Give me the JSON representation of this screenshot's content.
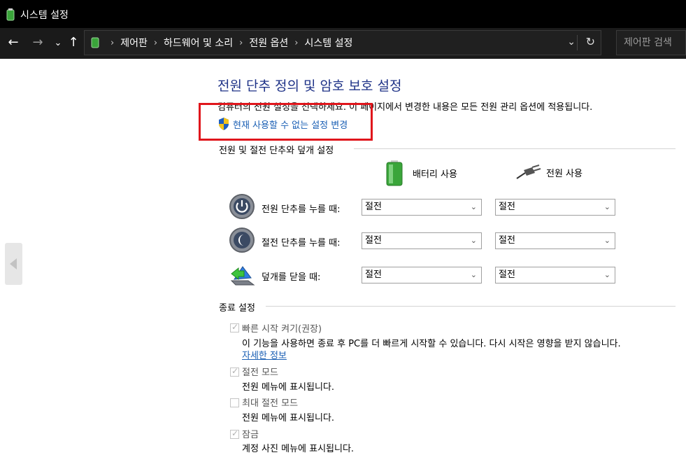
{
  "window": {
    "title": "시스템 설정"
  },
  "breadcrumbs": [
    "제어판",
    "하드웨어 및 소리",
    "전원 옵션",
    "시스템 설정"
  ],
  "search": {
    "placeholder": "제어판 검색"
  },
  "main": {
    "heading": "전원 단추 정의 및 암호 보호 설정",
    "description": "컴퓨터의 전원 설정을 선택하세요. 이 페이지에서 변경한 내용은 모든 전원 관리 옵션에 적용됩니다.",
    "change_link": "현재 사용할 수 없는 설정 변경",
    "power_section": {
      "title": "전원 및 절전 단추와 덮개 설정",
      "col_battery": "배터리 사용",
      "col_plugged": "전원 사용",
      "rows": [
        {
          "label": "전원 단추를 누를 때:",
          "battery": "절전",
          "plugged": "절전"
        },
        {
          "label": "절전 단추를 누를 때:",
          "battery": "절전",
          "plugged": "절전"
        },
        {
          "label": "덮개를 닫을 때:",
          "battery": "절전",
          "plugged": "절전"
        }
      ]
    },
    "shutdown_section": {
      "title": "종료 설정",
      "items": [
        {
          "label": "빠른 시작 켜기(권장)",
          "checked": true,
          "desc": "이 기능을 사용하면 종료 후 PC를 더 빠르게 시작할 수 있습니다. 다시 시작은 영향을 받지 않습니다.",
          "link": "자세한 정보"
        },
        {
          "label": "절전 모드",
          "checked": true,
          "desc": "전원 메뉴에 표시됩니다."
        },
        {
          "label": "최대 절전 모드",
          "checked": false,
          "desc": "전원 메뉴에 표시됩니다."
        },
        {
          "label": "잠금",
          "checked": true,
          "desc": "계정 사진 메뉴에 표시됩니다."
        }
      ]
    }
  },
  "colors": {
    "heading": "#1e3287",
    "link": "#1a5fb4",
    "highlight": "#e0161c"
  }
}
